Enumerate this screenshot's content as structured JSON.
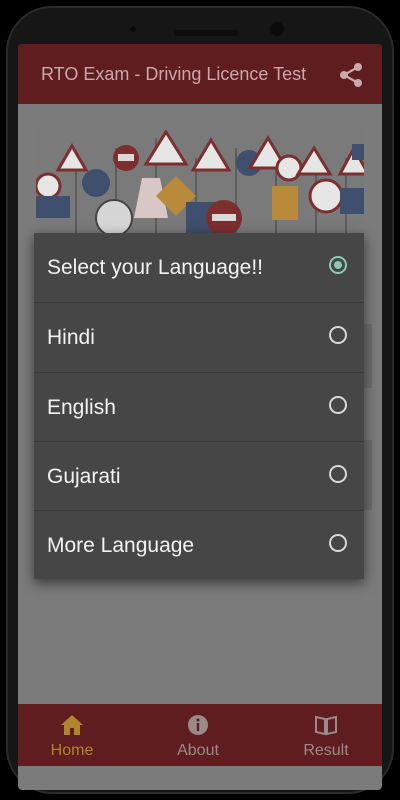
{
  "app": {
    "title": "RTO Exam - Driving Licence Test"
  },
  "dialog": {
    "options": [
      {
        "label": "Select your Language!!",
        "selected": true
      },
      {
        "label": "Hindi",
        "selected": false
      },
      {
        "label": "English",
        "selected": false
      },
      {
        "label": "Gujarati",
        "selected": false
      },
      {
        "label": "More Language",
        "selected": false
      }
    ]
  },
  "bottom_nav": {
    "items": [
      {
        "label": "Home",
        "icon": "home-icon",
        "active": true
      },
      {
        "label": "About",
        "icon": "info-icon",
        "active": false
      },
      {
        "label": "Result",
        "icon": "book-icon",
        "active": false
      }
    ]
  },
  "colors": {
    "appbar": "#5f1d1f",
    "active_tab": "#b0862c",
    "radio_selected": "#8ec7b3",
    "dialog_bg": "#464646"
  }
}
